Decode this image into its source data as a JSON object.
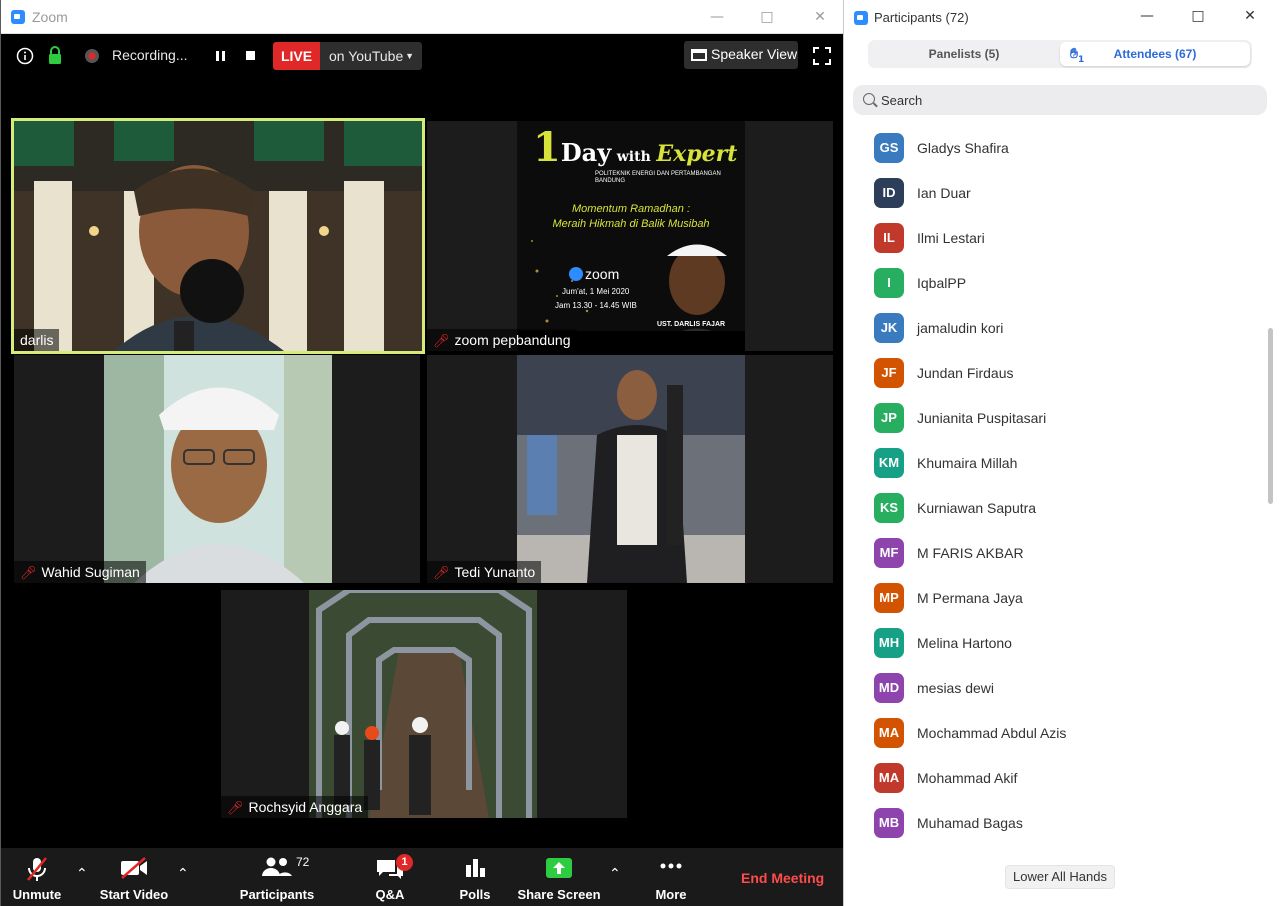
{
  "zoom_window": {
    "title": "Zoom",
    "recording_label": "Recording...",
    "live_label": "LIVE",
    "stream_target": "on YouTube",
    "speaker_view_label": "Speaker View"
  },
  "tiles": [
    {
      "name": "darlis",
      "muted": false,
      "active": true
    },
    {
      "name": "zoom pepbandung",
      "muted": true,
      "active": false
    },
    {
      "name": "Wahid Sugiman",
      "muted": true,
      "active": false
    },
    {
      "name": "Tedi Yunanto",
      "muted": true,
      "active": false
    },
    {
      "name": "Rochsyid Anggara",
      "muted": true,
      "active": false
    }
  ],
  "poster": {
    "title_1": "1",
    "title_day": "Day",
    "title_with": "with",
    "title_expert": "Expert",
    "institution": "POLITEKNIK ENERGI DAN PERTAMBANGAN BANDUNG",
    "theme_line1": "Momentum Ramadhan :",
    "theme_line2": "Meraih Hikmah di Balik Musibah",
    "platform": "zoom",
    "date": "Jum'at, 1 Mei 2020",
    "time": "Jam 13.30 - 14.45 WIB",
    "speaker": "UST. DARLIS FAJAR"
  },
  "toolbar": {
    "unmute": "Unmute",
    "start_video": "Start Video",
    "participants": "Participants",
    "participants_count": "72",
    "qa": "Q&A",
    "qa_badge": "1",
    "polls": "Polls",
    "share_screen": "Share Screen",
    "more": "More",
    "end_meeting": "End Meeting"
  },
  "panel": {
    "title": "Participants (72)",
    "tab_panelists": "Panelists (5)",
    "tab_attendees": "Attendees (67)",
    "hands_raised": "1",
    "search_placeholder": "Search",
    "lower_all_hands": "Lower All Hands",
    "attendees": [
      {
        "initials": "GS",
        "name": "Gladys Shafira",
        "color": "#3a7bbf"
      },
      {
        "initials": "ID",
        "name": "Ian Duar",
        "color": "#2c3e5a"
      },
      {
        "initials": "IL",
        "name": "Ilmi Lestari",
        "color": "#c0392b"
      },
      {
        "initials": "I",
        "name": "IqbalPP",
        "color": "#27ae60"
      },
      {
        "initials": "JK",
        "name": "jamaludin kori",
        "color": "#3a7bbf"
      },
      {
        "initials": "JF",
        "name": "Jundan Firdaus",
        "color": "#d35400"
      },
      {
        "initials": "JP",
        "name": "Junianita Puspitasari",
        "color": "#27ae60"
      },
      {
        "initials": "KM",
        "name": "Khumaira Millah",
        "color": "#16a085"
      },
      {
        "initials": "KS",
        "name": "Kurniawan Saputra",
        "color": "#27ae60"
      },
      {
        "initials": "MF",
        "name": "M FARIS AKBAR",
        "color": "#8e44ad"
      },
      {
        "initials": "MP",
        "name": "M Permana Jaya",
        "color": "#d35400"
      },
      {
        "initials": "MH",
        "name": "Melina Hartono",
        "color": "#16a085"
      },
      {
        "initials": "MD",
        "name": "mesias dewi",
        "color": "#8e44ad"
      },
      {
        "initials": "MA",
        "name": "Mochammad Abdul Azis",
        "color": "#d35400"
      },
      {
        "initials": "MA",
        "name": "Mohammad Akif",
        "color": "#c0392b"
      },
      {
        "initials": "MB",
        "name": "Muhamad Bagas",
        "color": "#8e44ad"
      }
    ]
  }
}
